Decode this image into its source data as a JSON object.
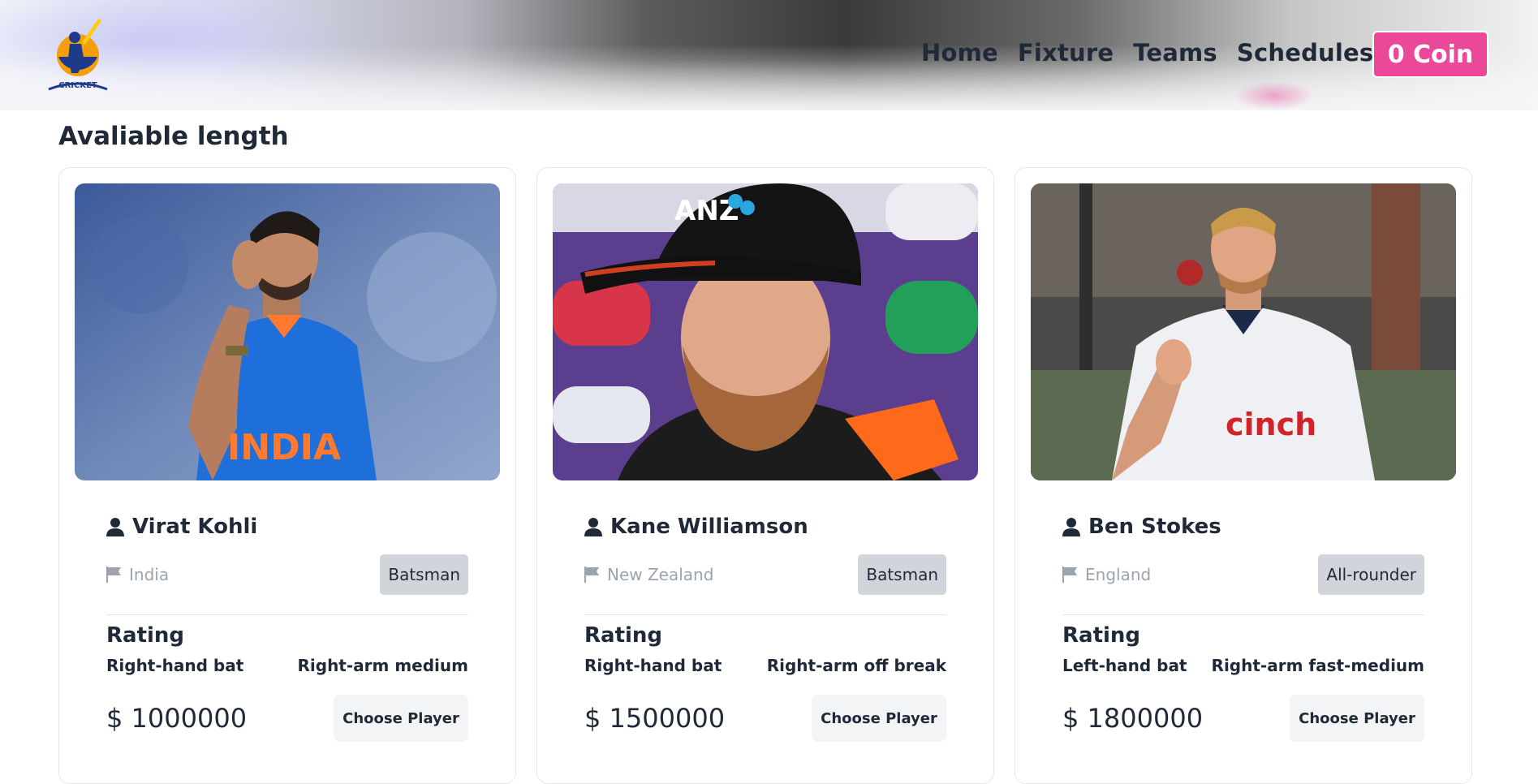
{
  "header": {
    "logo_text": "CRICKET",
    "nav": [
      "Home",
      "Fixture",
      "Teams",
      "Schedules"
    ],
    "coin_label": "0 Coin",
    "accent_color": "#ec4899"
  },
  "section": {
    "title": "Avaliable length"
  },
  "players": [
    {
      "name": "Virat Kohli",
      "country": "India",
      "role": "Batsman",
      "rating_label": "Rating",
      "batting": "Right-hand bat",
      "bowling": "Right-arm medium",
      "price": "$ 1000000",
      "button": "Choose Player",
      "jersey_text": "INDIA"
    },
    {
      "name": "Kane Williamson",
      "country": "New Zealand",
      "role": "Batsman",
      "rating_label": "Rating",
      "batting": "Right-hand bat",
      "bowling": "Right-arm off break",
      "price": "$ 1500000",
      "button": "Choose Player",
      "cap_text": "ANZ"
    },
    {
      "name": "Ben Stokes",
      "country": "England",
      "role": "All-rounder",
      "rating_label": "Rating",
      "batting": "Left-hand bat",
      "bowling": "Right-arm fast-medium",
      "price": "$ 1800000",
      "button": "Choose Player",
      "jersey_text": "cinch"
    }
  ]
}
